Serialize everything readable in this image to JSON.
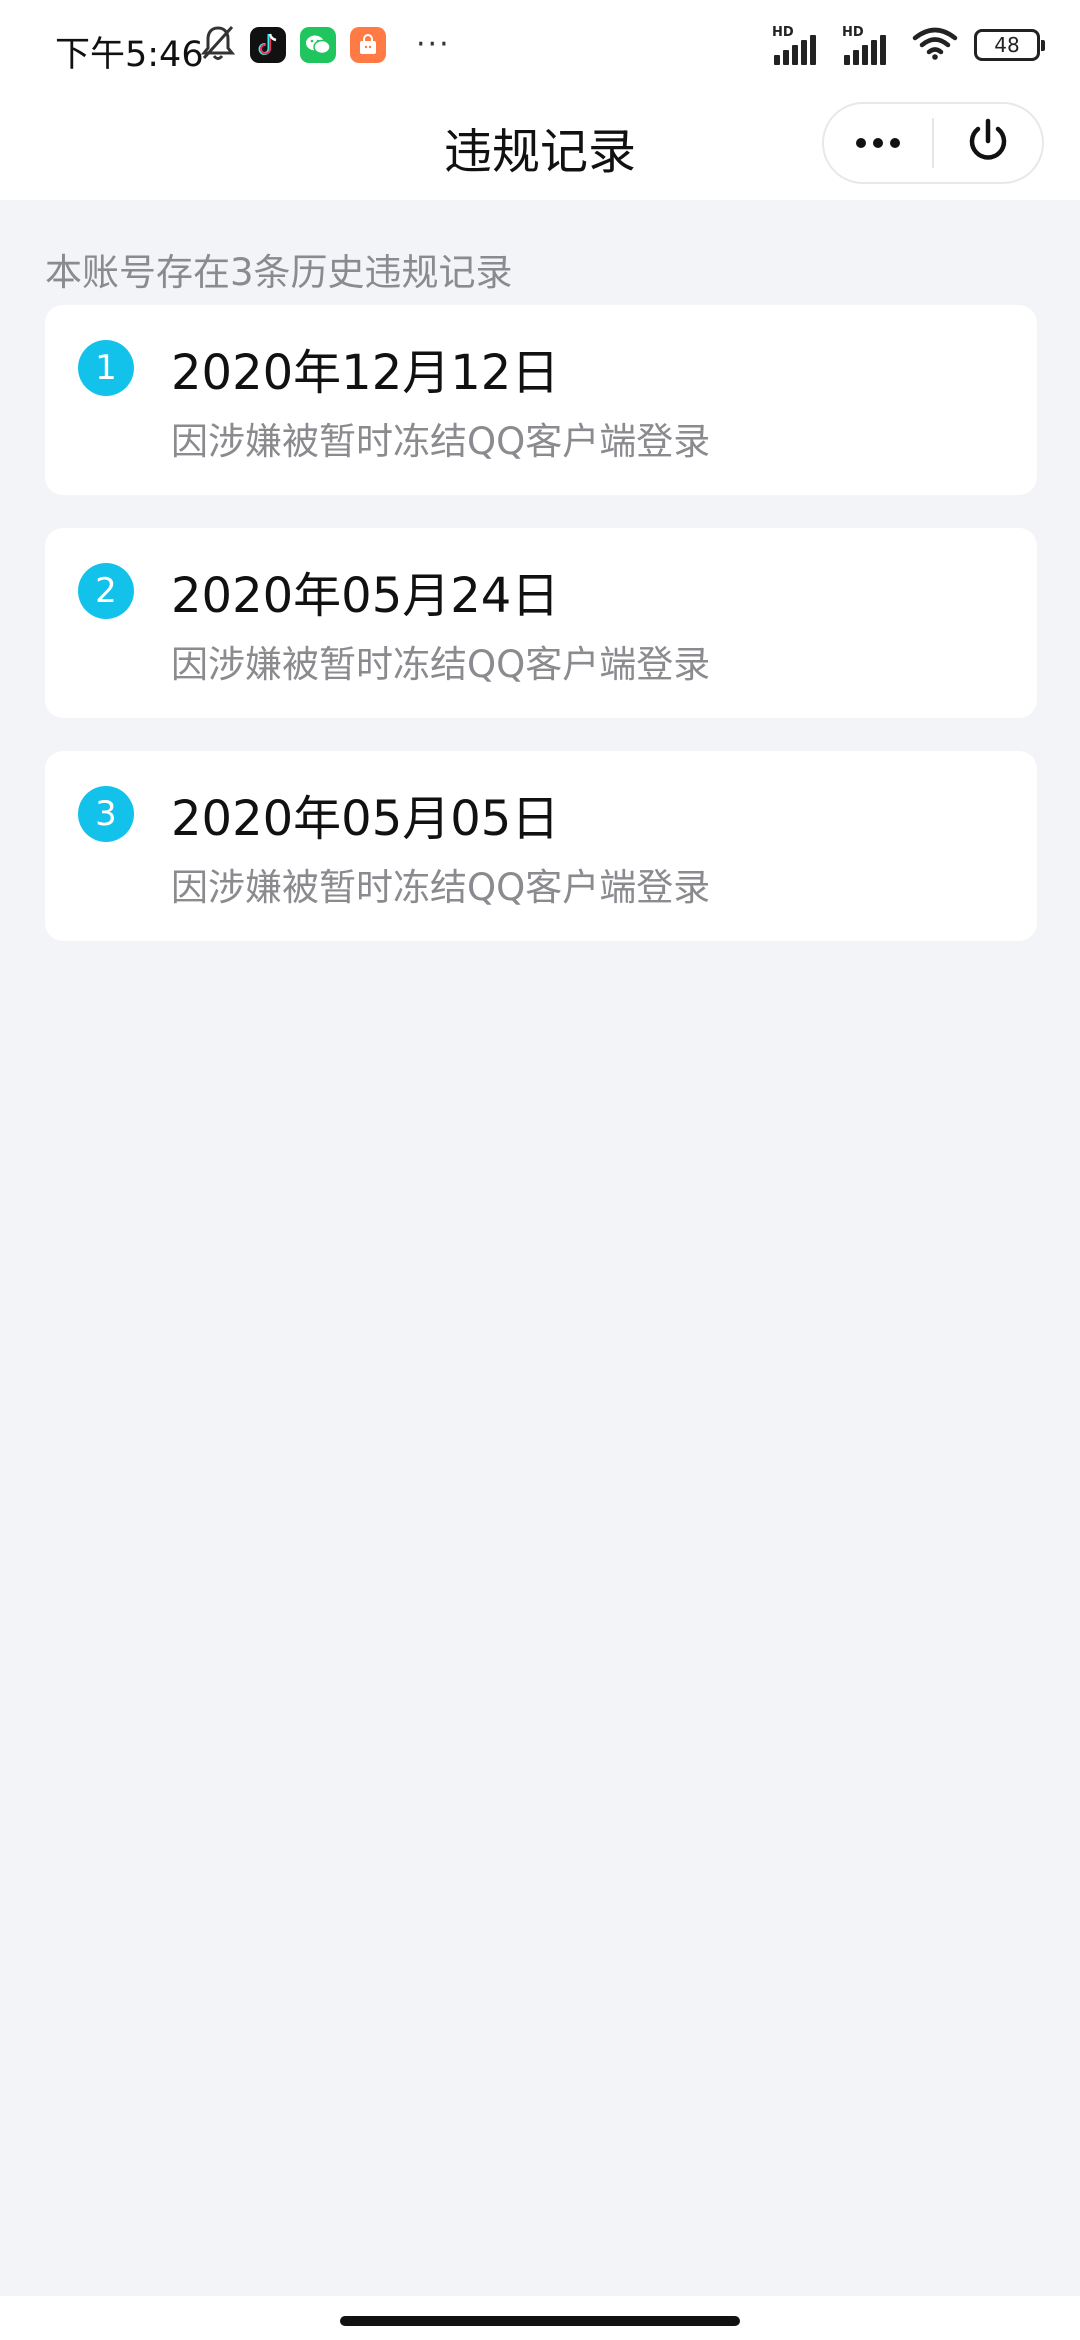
{
  "status_bar": {
    "time": "下午5:46",
    "battery": "48",
    "signal_label": "HD",
    "more_indicator": "···",
    "app_icons": [
      "muted-bell-icon",
      "tiktok-icon",
      "wechat-icon",
      "shopping-bag-icon"
    ]
  },
  "header": {
    "title": "违规记录",
    "more_button": "more-options",
    "power_button": "close-miniprogram"
  },
  "summary": "本账号存在3条历史违规记录",
  "records": [
    {
      "index": "1",
      "date": "2020年12月12日",
      "description": "因涉嫌被暂时冻结QQ客户端登录"
    },
    {
      "index": "2",
      "date": "2020年05月24日",
      "description": "因涉嫌被暂时冻结QQ客户端登录"
    },
    {
      "index": "3",
      "date": "2020年05月05日",
      "description": "因涉嫌被暂时冻结QQ客户端登录"
    }
  ],
  "colors": {
    "accent": "#13c2ea",
    "background": "#f3f4f8",
    "card": "#ffffff",
    "muted_text": "#8a8a8f"
  }
}
